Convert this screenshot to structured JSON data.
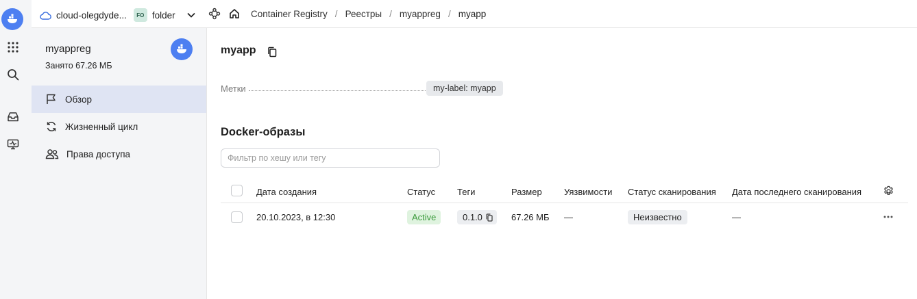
{
  "topbar": {
    "cloud_name": "cloud-olegdyde...",
    "folder_badge": "FO",
    "folder_name": "folder",
    "breadcrumbs": [
      "Container Registry",
      "Реестры",
      "myappreg",
      "myapp"
    ]
  },
  "sidebar": {
    "registry_name": "myappreg",
    "registry_used": "Занято 67.26 МБ",
    "items": [
      {
        "label": "Обзор",
        "icon": "flag-icon",
        "active": true
      },
      {
        "label": "Жизненный цикл",
        "icon": "refresh-icon",
        "active": false
      },
      {
        "label": "Права доступа",
        "icon": "users-icon",
        "active": false
      }
    ]
  },
  "main": {
    "title": "myapp",
    "labels_key": "Метки",
    "label_value": "my-label: myapp",
    "section_title": "Docker-образы",
    "filter_placeholder": "Фильтр по хешу или тегу",
    "columns": [
      "Дата создания",
      "Статус",
      "Теги",
      "Размер",
      "Уязвимости",
      "Статус сканирования",
      "Дата последнего сканирования"
    ],
    "rows": [
      {
        "created": "20.10.2023, в 12:30",
        "status": "Active",
        "tag": "0.1.0",
        "size": "67.26 МБ",
        "vulnerabilities": "—",
        "scan_status": "Неизвестно",
        "last_scan": "—"
      }
    ]
  },
  "colors": {
    "accent": "#4d7ff1",
    "active_nav": "#dfe4f3",
    "status_active_bg": "#dff3df",
    "status_active_text": "#3a9a3a"
  }
}
